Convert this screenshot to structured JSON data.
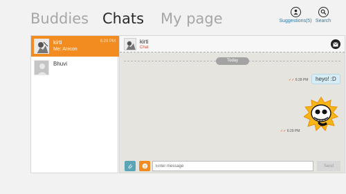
{
  "nav": {
    "tabs": [
      {
        "label": "Buddies",
        "active": false
      },
      {
        "label": "Chats",
        "active": true
      },
      {
        "label": "My page",
        "active": false
      }
    ],
    "actions": {
      "suggestions_label": "Suggestions(5)",
      "search_label": "Search"
    }
  },
  "contacts": [
    {
      "name": "kirti",
      "preview": "Me: Anicon",
      "time": "6:29 PM",
      "selected": true
    },
    {
      "name": "Bhuvi",
      "preview": "",
      "time": "",
      "selected": false
    }
  ],
  "chat": {
    "header": {
      "name": "kirti",
      "subtitle": "Chat"
    },
    "day_label": "Today",
    "messages": [
      {
        "text": "heyo! :D",
        "time": "6:28 PM",
        "type": "text"
      },
      {
        "text": "",
        "time": "6:29 PM",
        "type": "sticker"
      }
    ],
    "compose": {
      "placeholder": "Enter message",
      "send_label": "Send"
    }
  },
  "colors": {
    "accent": "#f28b20",
    "link": "#2a7aa8",
    "bubble": "#d6ecf6"
  }
}
